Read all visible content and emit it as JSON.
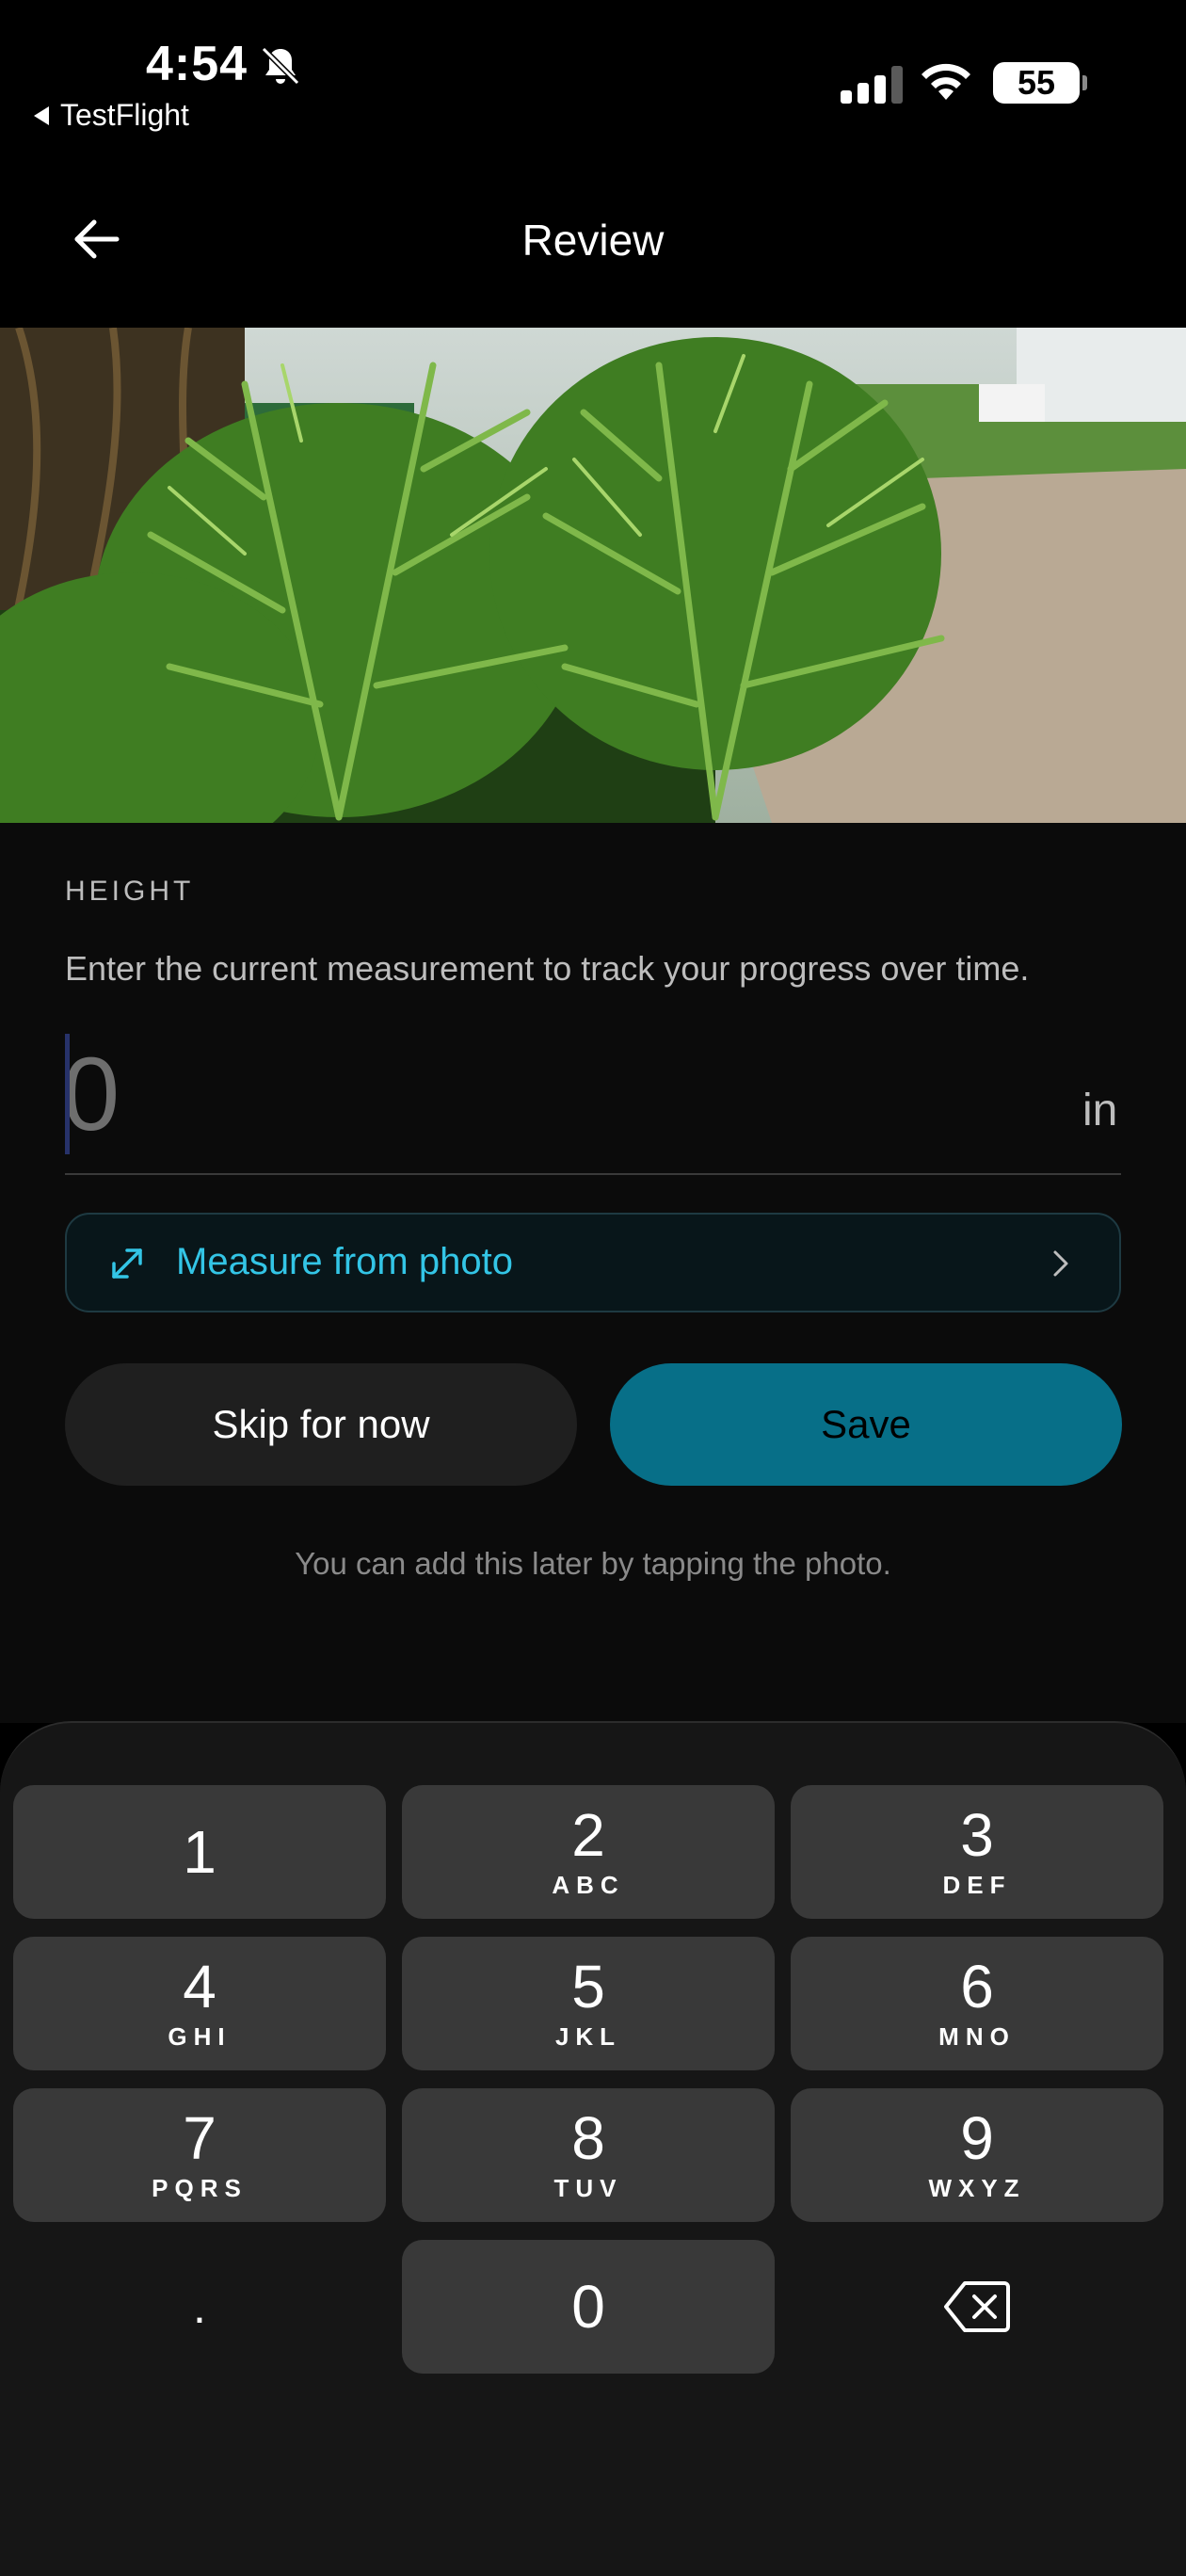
{
  "status_bar": {
    "time": "4:54",
    "back_app": "TestFlight",
    "battery": "55"
  },
  "header": {
    "title": "Review"
  },
  "measurement": {
    "section_label": "HEIGHT",
    "helper_text": "Enter the current measurement to track your progress over time.",
    "value_placeholder": "0",
    "unit": "in"
  },
  "measure_from_photo": {
    "label": "Measure from photo"
  },
  "actions": {
    "skip_label": "Skip for now",
    "save_label": "Save",
    "later_note": "You can add this later by tapping the photo."
  },
  "keypad": {
    "keys": [
      {
        "digit": "1",
        "letters": ""
      },
      {
        "digit": "2",
        "letters": "ABC"
      },
      {
        "digit": "3",
        "letters": "DEF"
      },
      {
        "digit": "4",
        "letters": "GHI"
      },
      {
        "digit": "5",
        "letters": "JKL"
      },
      {
        "digit": "6",
        "letters": "MNO"
      },
      {
        "digit": "7",
        "letters": "PQRS"
      },
      {
        "digit": "8",
        "letters": "TUV"
      },
      {
        "digit": "9",
        "letters": "WXYZ"
      },
      {
        "digit": "0",
        "letters": ""
      }
    ],
    "decimal": ".",
    "delete_icon": "delete-backspace-icon"
  },
  "colors": {
    "accent": "#33c5e6",
    "save_button": "#076f88",
    "background": "#000000"
  }
}
